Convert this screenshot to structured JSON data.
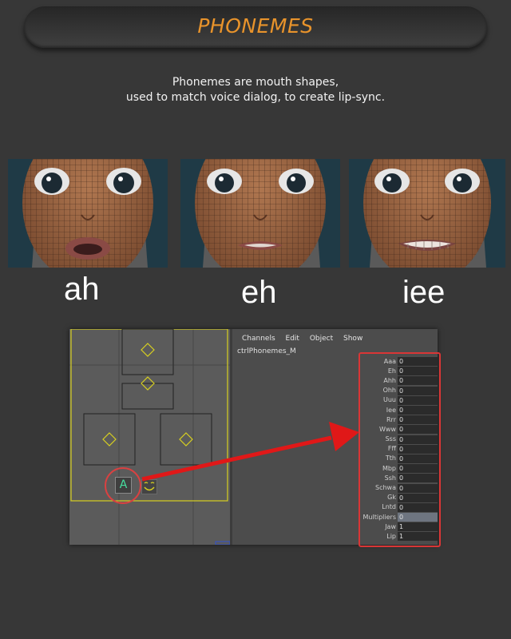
{
  "header": {
    "title": "PHONEMES"
  },
  "intro": {
    "line1": "Phonemes are mouth shapes,",
    "line2": "used to match voice dialog, to create lip-sync."
  },
  "faces": [
    {
      "label": "ah"
    },
    {
      "label": "eh"
    },
    {
      "label": "iee"
    }
  ],
  "editor": {
    "menu": [
      "Channels",
      "Edit",
      "Object",
      "Show"
    ],
    "node_name": "ctrlPhonemes_M",
    "mouth_control_glyph": "A",
    "channels": [
      {
        "name": "Aaa",
        "value": "0"
      },
      {
        "name": "Eh",
        "value": "0"
      },
      {
        "name": "Ahh",
        "value": "0"
      },
      {
        "name": "Ohh",
        "value": "0"
      },
      {
        "name": "Uuu",
        "value": "0"
      },
      {
        "name": "Iee",
        "value": "0"
      },
      {
        "name": "Rrr",
        "value": "0"
      },
      {
        "name": "Www",
        "value": "0"
      },
      {
        "name": "Sss",
        "value": "0"
      },
      {
        "name": "Fff",
        "value": "0"
      },
      {
        "name": "Tth",
        "value": "0"
      },
      {
        "name": "Mbp",
        "value": "0"
      },
      {
        "name": "Ssh",
        "value": "0"
      },
      {
        "name": "Schwa",
        "value": "0"
      },
      {
        "name": "Gk",
        "value": "0"
      },
      {
        "name": "Lntd",
        "value": "0"
      },
      {
        "name": "Multipliers",
        "value": "0"
      },
      {
        "name": "Jaw",
        "value": "1"
      },
      {
        "name": "Lip",
        "value": "1"
      }
    ]
  },
  "colors": {
    "accent": "#e8932b",
    "highlight": "#d93636",
    "control_outline": "#d8d020"
  }
}
